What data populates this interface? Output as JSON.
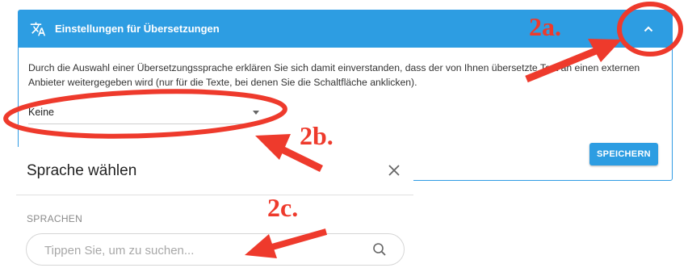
{
  "panel": {
    "title": "Einstellungen für Übersetzungen",
    "description": "Durch die Auswahl einer Übersetzungssprache erklären Sie sich damit einverstanden, dass der von Ihnen übersetzte Text an einen externen Anbieter weitergegeben wird (nur für die Texte, bei denen Sie die Schaltfläche anklicken).",
    "language_select_value": "Keine",
    "save_label": "SPEICHERN",
    "accent_color": "#2d9de2"
  },
  "dialog": {
    "title": "Sprache wählen",
    "section_label": "SPRACHEN",
    "search_placeholder": "Tippen Sie, um zu suchen..."
  },
  "annotations": {
    "step_a": "2a.",
    "step_b": "2b.",
    "step_c": "2c.",
    "color": "#ee3a2c"
  },
  "icons": {
    "header": "translate-icon",
    "collapse": "chevron-up-icon",
    "close": "close-icon",
    "search": "search-icon"
  }
}
